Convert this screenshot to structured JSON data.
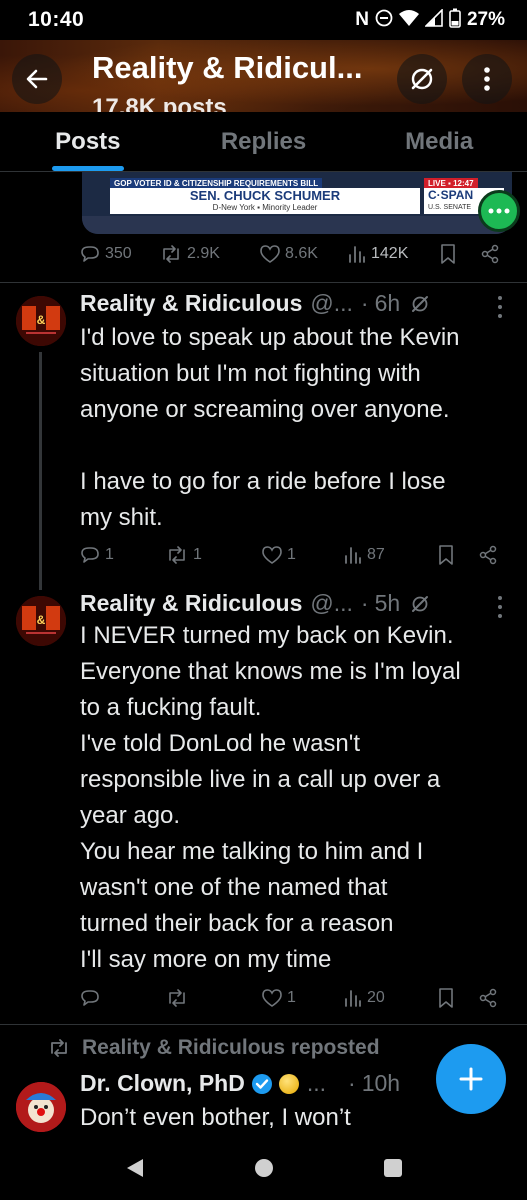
{
  "status_bar": {
    "time": "10:40",
    "battery": "27%",
    "icons": [
      "nfc-icon",
      "dnd-icon",
      "wifi-icon",
      "signal-icon",
      "battery-icon"
    ]
  },
  "header": {
    "title": "Reality & Ridicul...",
    "subtitle": "17.8K posts"
  },
  "tabs": [
    {
      "label": "Posts",
      "active": true
    },
    {
      "label": "Replies",
      "active": false
    },
    {
      "label": "Media",
      "active": false
    }
  ],
  "video": {
    "chyron_top": "GOP VOTER ID & CITIZENSHIP REQUIREMENTS BILL",
    "name": "SEN. CHUCK SCHUMER",
    "sub": "D-New York  ▪  Minority Leader",
    "live": "LIVE ▪ 12:47",
    "network": "C·SPAN",
    "network_sub": "U.S. SENATE"
  },
  "tweet0_actions": {
    "replies": "350",
    "reposts": "2.9K",
    "likes": "8.6K",
    "views": "142K"
  },
  "tweet1": {
    "name": "Reality & Ridiculous",
    "handle": "@...",
    "dot": "·",
    "time": "6h",
    "lines": [
      "I'd love to speak up about the Kevin",
      "situation but I'm not fighting with",
      "anyone or screaming over anyone.",
      "",
      "I have to go for a ride before I lose",
      "my shit."
    ],
    "replies": "1",
    "reposts": "1",
    "likes": "1",
    "views": "87"
  },
  "tweet2": {
    "name": "Reality & Ridiculous",
    "handle": "@...",
    "dot": "·",
    "time": "5h",
    "lines": [
      "I NEVER turned my back on Kevin.",
      "Everyone that knows me is I'm loyal",
      "to a fucking fault.",
      "I've told DonLod he wasn't",
      "responsible live in a call up over a",
      "year ago.",
      "You hear me talking to him and I",
      "wasn't one of the named that",
      "turned their back for a reason",
      "I'll say more on my time"
    ],
    "likes": "1",
    "views": "20"
  },
  "repost_label": "Reality & Ridiculous reposted",
  "tweet3": {
    "name": "Dr. Clown, PhD",
    "handle": "...",
    "dot": "·",
    "time": "10h",
    "lines": [
      "Don’t even bother, I won’t"
    ]
  },
  "colors": {
    "accent": "#1d9bf0",
    "muted": "#71767b",
    "text": "#e7e9ea",
    "divider": "#2f3336"
  }
}
